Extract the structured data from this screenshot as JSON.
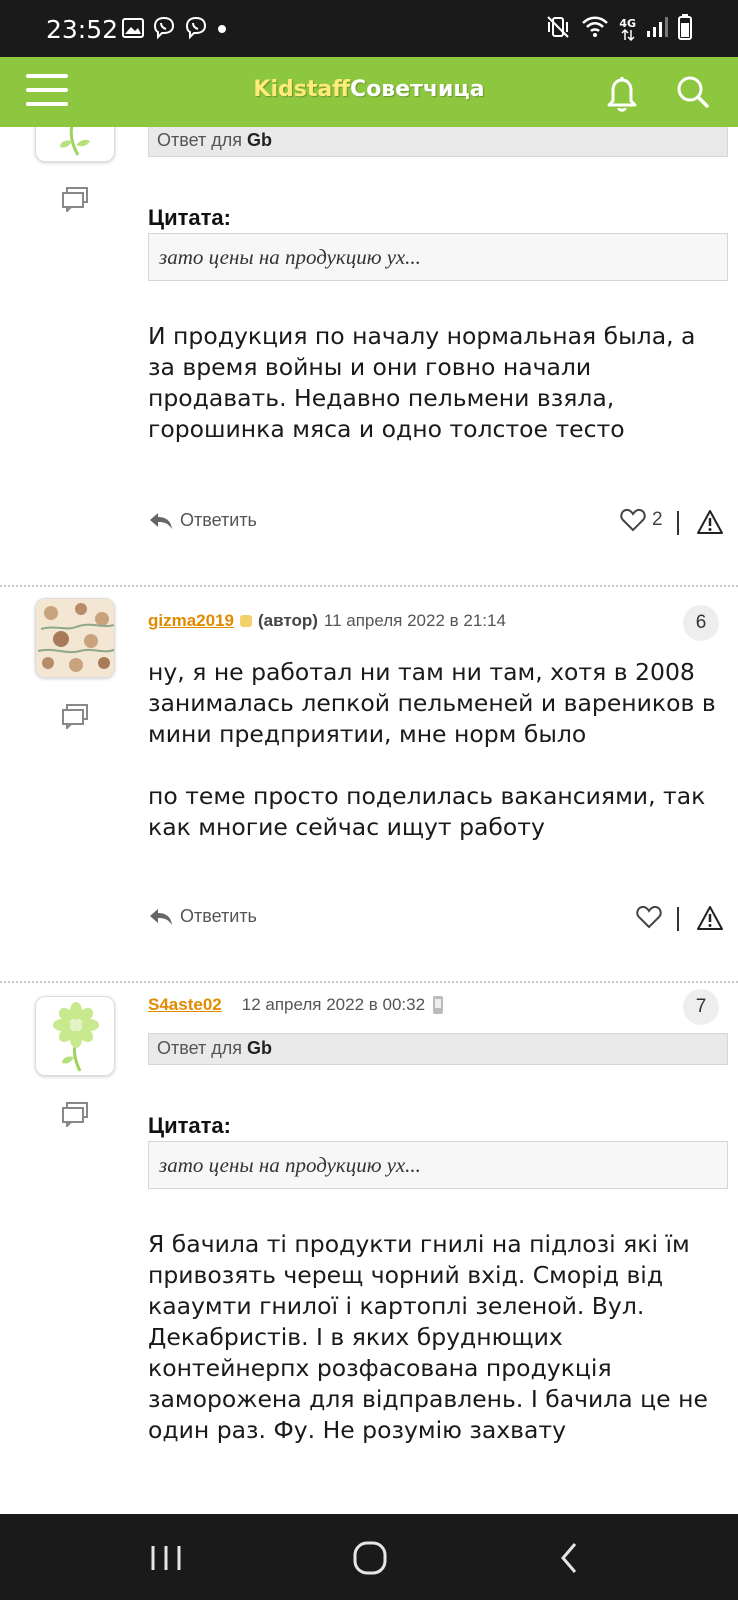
{
  "status_bar": {
    "time": "23:52",
    "left_icons": [
      "image-icon",
      "viber-icon",
      "viber-icon",
      "dot-icon"
    ],
    "right_icons": [
      "vibrate-mute-icon",
      "wifi-icon",
      "network-4g-icon",
      "signal-icon",
      "battery-icon"
    ],
    "network_label": "4G"
  },
  "app_bar": {
    "brand_part1": "Kidstaff",
    "brand_part2": "Советчица",
    "brand_color": "#8dc63f",
    "brand_accent": "#ffeb7a"
  },
  "posts": [
    {
      "reply_to_prefix": "Ответ для",
      "reply_to_user": "Gb",
      "quote_label": "Цитата:",
      "quote_text": "зато цены на продукцию ух...",
      "body": "И продукция по началу нормальная была, а за время войны и они говно начали продавать. Недавно пельмени взяла, горошинка мяса и одно толстое тесто",
      "reply_label": "Ответить",
      "likes": "2"
    },
    {
      "username": "gizma2019",
      "author_tag": "(автор)",
      "date": "11 апреля 2022 в 21:14",
      "number": "6",
      "body": "ну, я не работал ни там ни там, хотя в 2008 занималась лепкой пельменей и вареников в мини предприятии, мне норм было\n\nпо теме просто поделилась вакансиями, так как многие сейчас ищут работу",
      "reply_label": "Ответить"
    },
    {
      "username": "S4aste02",
      "date": "12 апреля 2022 в 00:32",
      "number": "7",
      "reply_to_prefix": "Ответ для",
      "reply_to_user": "Gb",
      "quote_label": "Цитата:",
      "quote_text": "зато цены на продукцию ух...",
      "body": "Я бачила ті продукти гнилі на підлозі які їм привозять черещ чорний вхід. Сморід від кааумти гнилої і картоплі зеленой. Вул. Декабристів. І в яких бруднющих контейнерпх розфасована продукція заморожена для відправлень. І бачила це не один раз. Фу. Не розумію захвату"
    }
  ],
  "nav_bar": {
    "buttons": [
      "recent-apps-icon",
      "home-icon",
      "back-icon"
    ]
  }
}
